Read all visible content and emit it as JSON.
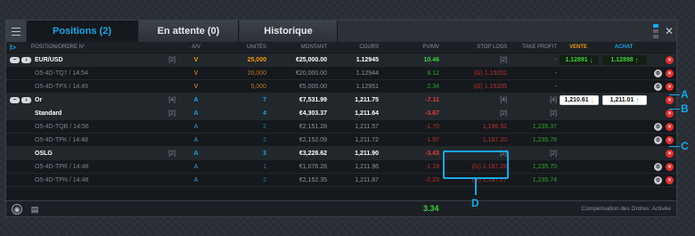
{
  "tabs": [
    {
      "label": "Positions (2)",
      "active": true
    },
    {
      "label": "En attente (0)",
      "active": false
    },
    {
      "label": "Historique",
      "active": false
    }
  ],
  "headers": {
    "expand": "I>",
    "position": "POSITION/ORDRE N°",
    "av": "A/V",
    "units": "UNITÉS",
    "amount": "MONTANT",
    "cours": "COURS",
    "pvmv": "PV/MV",
    "stop": "STOP LOSS",
    "tp": "TAKE PROFIT",
    "vente": "VENTE",
    "achat": "ACHAT"
  },
  "rows": [
    {
      "type": "parent",
      "name": "EUR/USD",
      "count": "[2]",
      "av": "V",
      "units": "25,000",
      "amount": "€25,000.00",
      "cours": "1.12945",
      "pvmv": "10.46",
      "stop": "[2]",
      "tp": "-",
      "vente": "1.12891",
      "achat": "1.12898"
    },
    {
      "type": "child",
      "name": "O5-4D-TQ7 / 14:54",
      "av": "V",
      "units": "20,000",
      "amount": "€20,000.00",
      "cours": "1.12944",
      "pvmv": "8.12",
      "stop": "(G) 1.15202",
      "tp": "-"
    },
    {
      "type": "child",
      "name": "O5-4D-TPX / 14:49",
      "av": "V",
      "units": "5,000",
      "amount": "€5,000.00",
      "cours": "1.12951",
      "pvmv": "2.34",
      "stop": "(G) 1.15205",
      "tp": "-"
    },
    {
      "type": "parent",
      "name": "Or",
      "count": "[4]",
      "av": "A",
      "units": "7",
      "amount": "€7,531.99",
      "cours": "1,211.75",
      "pvmv": "-7.11",
      "stop": "[4]",
      "tp": "[4]",
      "vente": "1,210.61",
      "achat": "1,211.01"
    },
    {
      "type": "sub",
      "name": "Standard",
      "count": "[2]",
      "av": "A",
      "units": "4",
      "amount": "€4,303.37",
      "cours": "1,211.64",
      "pvmv": "-3.67",
      "stop": "[2]",
      "tp": "[2]"
    },
    {
      "type": "child",
      "name": "O5-4D-TQB / 14:56",
      "av": "A",
      "units": "2",
      "amount": "€2,151.28",
      "cours": "1,211.57",
      "pvmv": "-1.70",
      "stop": "1,186.92",
      "tp": "1,235.37"
    },
    {
      "type": "child",
      "name": "O5-4D-TPK / 14:48",
      "av": "A",
      "units": "2",
      "amount": "€2,152.09",
      "cours": "1,211.72",
      "pvmv": "-1.97",
      "stop": "1,187.20",
      "tp": "1,235.76"
    },
    {
      "type": "sub",
      "name": "OSLG",
      "count": "[2]",
      "av": "A",
      "units": "3",
      "amount": "€3,228.62",
      "cours": "1,211.90",
      "pvmv": "-3.43",
      "stop": "[2]",
      "tp": "[2]"
    },
    {
      "type": "child",
      "name": "O5-4D-TPR / 14:48",
      "av": "A",
      "units": "1",
      "amount": "€1,076.26",
      "cours": "1,211.96",
      "pvmv": "-1.19",
      "stop": "(G) 1,187.26",
      "tp": "1,235.70"
    },
    {
      "type": "child",
      "name": "O5-4D-TPN / 14:48",
      "av": "A",
      "units": "2",
      "amount": "€2,152.35",
      "cours": "1,211.87",
      "pvmv": "-2.23",
      "stop": "(G) 1,187.27",
      "tp": "1,235.74"
    }
  ],
  "footer": {
    "total": "3.34",
    "compensation": "Compensation des Ordres: Activée"
  },
  "callouts": {
    "a": "A",
    "b": "B",
    "c": "C",
    "d": "D"
  },
  "icons": {
    "collapse": "−",
    "expand_arrow": "›",
    "gear": "⚙",
    "delete": "×",
    "arrow_down": "↓",
    "arrow_up": "↑",
    "close": "✕"
  },
  "colors": {
    "accent": "#1aa6e8",
    "sell": "#f39c12",
    "profit": "#3ed13e",
    "loss": "#e33c3c"
  }
}
